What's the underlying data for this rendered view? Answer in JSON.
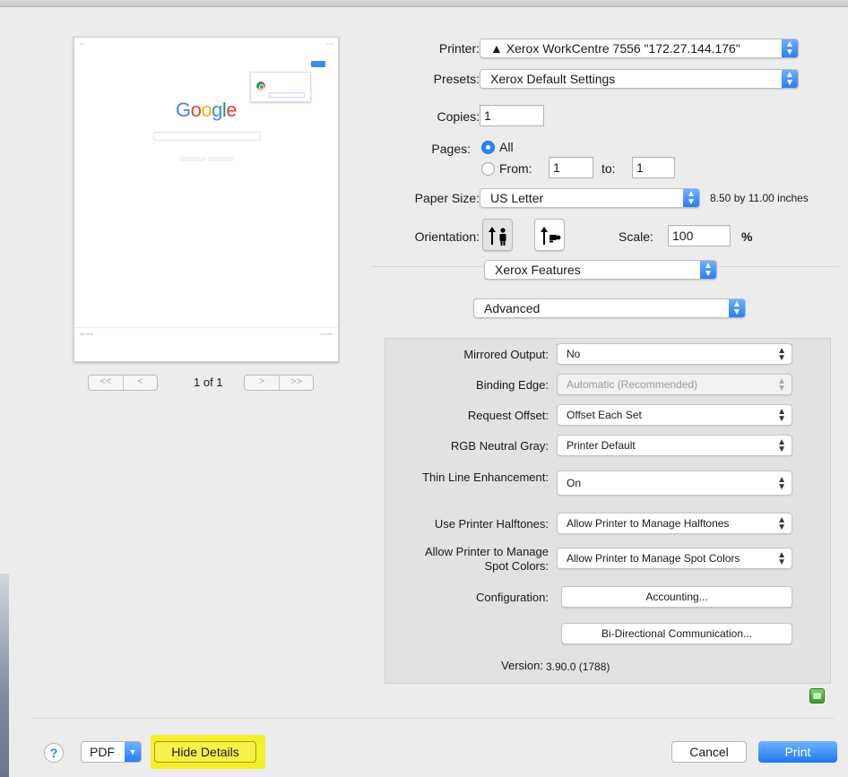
{
  "preview": {
    "logo_text": "Google",
    "page_indicator": "1 of 1",
    "nav_first": "<<",
    "nav_prev": "<",
    "nav_next": ">",
    "nav_last": ">>"
  },
  "printer": {
    "label": "Printer:",
    "value": "▲ Xerox WorkCentre 7556 \"172.27.144.176\""
  },
  "presets": {
    "label": "Presets:",
    "value": "Xerox Default Settings"
  },
  "copies": {
    "label": "Copies:",
    "value": "1"
  },
  "pages": {
    "label": "Pages:",
    "all_label": "All",
    "selected": "All",
    "from_label": "From:",
    "from_value": "1",
    "to_label": "to:",
    "to_value": "1"
  },
  "paper_size": {
    "label": "Paper Size:",
    "value": "US Letter",
    "dimensions": "8.50 by 11.00 inches"
  },
  "orientation": {
    "label": "Orientation:",
    "selected": "portrait",
    "icons": [
      "portrait-icon",
      "landscape-icon"
    ]
  },
  "scale": {
    "label": "Scale:",
    "value": "100",
    "unit": "%"
  },
  "section_menu": "Xerox Features",
  "subsection_menu": "Advanced",
  "advanced": {
    "mirrored_output": {
      "label": "Mirrored Output:",
      "value": "No"
    },
    "binding_edge": {
      "label": "Binding Edge:",
      "value": "Automatic (Recommended)"
    },
    "request_offset": {
      "label": "Request Offset:",
      "value": "Offset Each Set"
    },
    "rgb_neutral_gray": {
      "label": "RGB Neutral Gray:",
      "value": "Printer Default"
    },
    "thin_line": {
      "label": "Thin Line Enhancement:",
      "value": "On"
    },
    "halftones": {
      "label": "Use Printer Halftones:",
      "value": "Allow Printer to Manage Halftones"
    },
    "spot_colors": {
      "label_line1": "Allow Printer to Manage",
      "label_line2": "Spot Colors:",
      "value": "Allow Printer to Manage Spot Colors"
    },
    "configuration": {
      "label": "Configuration:",
      "button1": "Accounting...",
      "button2": "Bi-Directional Communication..."
    },
    "version": {
      "label": "Version:",
      "value": "3.90.0 (1788)"
    }
  },
  "bottom": {
    "help": "?",
    "pdf": "PDF",
    "hide_details": "Hide Details",
    "cancel": "Cancel",
    "print": "Print"
  },
  "colors": {
    "accent": "#2a7ef5",
    "highlight": "#f6f02a"
  }
}
